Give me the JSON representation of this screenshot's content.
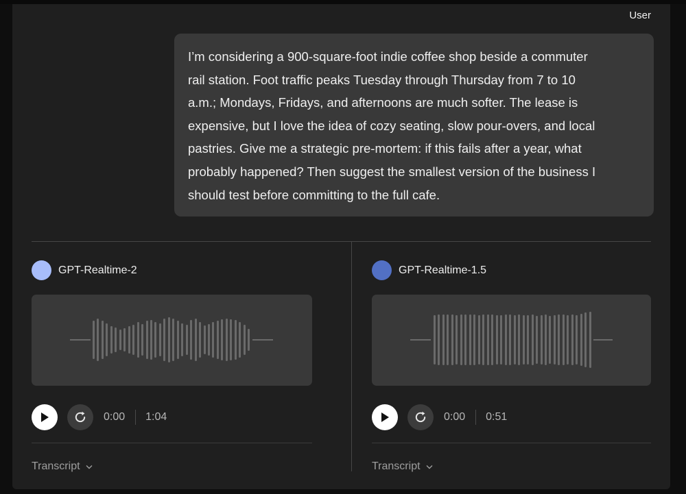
{
  "user_message": {
    "label": "User",
    "lines": [
      "I’m considering a 900-square-foot indie coffee shop beside a commuter",
      "rail station. Foot traffic peaks Tuesday through Thursday from 7 to 10",
      "a.m.; Mondays, Fridays, and afternoons are much softer. The lease is",
      "expensive, but I love the idea of cozy seating, slow pour-overs, and local",
      "pastries. Give me a strategic pre-mortem: if this fails after a year, what",
      "probably happened? Then suggest the smallest version of the business I",
      "should test before committing to the full cafe."
    ]
  },
  "responses": [
    {
      "model": "GPT-Realtime-2",
      "avatar_color": "#a8bdfa",
      "current_time": "0:00",
      "duration": "1:04",
      "transcript_label": "Transcript"
    },
    {
      "model": "GPT-Realtime-1.5",
      "avatar_color": "#5270c4",
      "current_time": "0:00",
      "duration": "0:51",
      "transcript_label": "Transcript"
    }
  ],
  "colors": {
    "background": "#0e0e0e",
    "panel": "#1f1f1f",
    "bubble": "#393939",
    "waveform": "#6a6a6a"
  }
}
